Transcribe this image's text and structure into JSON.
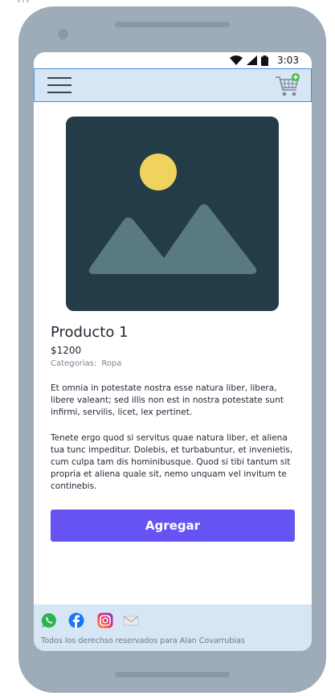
{
  "statusbar": {
    "time": "3:03"
  },
  "appbar": {
    "menu_icon": "hamburger-menu-icon",
    "cart_icon": "add-to-cart-icon"
  },
  "product": {
    "image_icon": "image-placeholder-icon",
    "title": "Producto 1",
    "price": "$1200",
    "categories_label": "Categorias:",
    "category": "Ropa",
    "description_1": "Et omnia in potestate nostra esse natura liber, libera, libere valeant; sed illis non est in nostra potestate sunt infirmi, servilis, licet, lex pertinet.",
    "description_2": "Tenete ergo quod si servitus quae natura liber, et aliena tua tunc impeditur. Dolebis, et turbabuntur, et invenietis, cum culpa tam dis hominibusque. Quod si tibi tantum sit propria et aliena quale sit, nemo unquam vel invitum te continebis.",
    "add_button": "Agregar",
    "accent_color": "#6654f2"
  },
  "footer": {
    "social_icons": [
      "whatsapp-icon",
      "facebook-icon",
      "instagram-icon",
      "mail-icon"
    ],
    "copyright": "Todos los derechso reservados para Alan Covarrubias"
  }
}
